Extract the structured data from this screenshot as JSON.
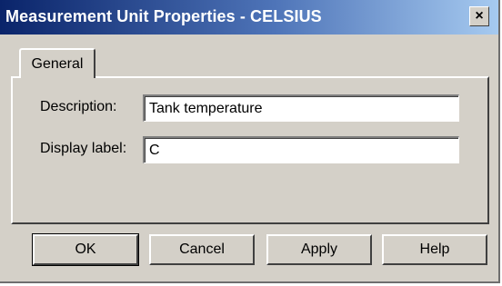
{
  "window": {
    "title": "Measurement Unit Properties - CELSIUS",
    "close_icon": "close-icon",
    "close_glyph": "×"
  },
  "tabs": [
    {
      "label": "General",
      "selected": true
    }
  ],
  "form": {
    "description_label": "Description:",
    "description_value": "Tank temperature",
    "display_label_label": "Display label:",
    "display_label_value": "C"
  },
  "buttons": {
    "ok": "OK",
    "cancel": "Cancel",
    "apply": "Apply",
    "help": "Help"
  },
  "colors": {
    "titlebar_start": "#0a246a",
    "titlebar_end": "#a6caf0",
    "dialog_face": "#d4d0c8"
  }
}
